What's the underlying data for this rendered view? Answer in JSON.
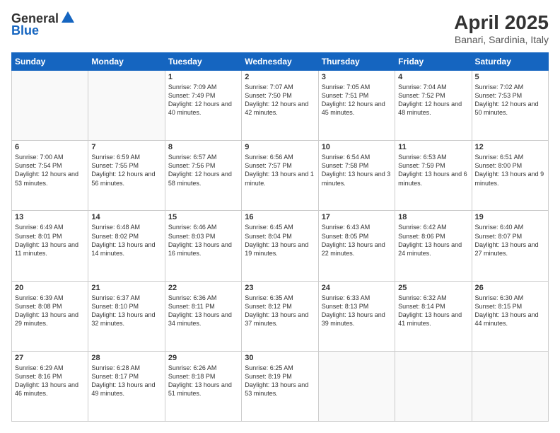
{
  "logo": {
    "line1": "General",
    "line2": "Blue"
  },
  "title": "April 2025",
  "subtitle": "Banari, Sardinia, Italy",
  "days_of_week": [
    "Sunday",
    "Monday",
    "Tuesday",
    "Wednesday",
    "Thursday",
    "Friday",
    "Saturday"
  ],
  "weeks": [
    [
      {
        "day": "",
        "info": ""
      },
      {
        "day": "",
        "info": ""
      },
      {
        "day": "1",
        "info": "Sunrise: 7:09 AM\nSunset: 7:49 PM\nDaylight: 12 hours and 40 minutes."
      },
      {
        "day": "2",
        "info": "Sunrise: 7:07 AM\nSunset: 7:50 PM\nDaylight: 12 hours and 42 minutes."
      },
      {
        "day": "3",
        "info": "Sunrise: 7:05 AM\nSunset: 7:51 PM\nDaylight: 12 hours and 45 minutes."
      },
      {
        "day": "4",
        "info": "Sunrise: 7:04 AM\nSunset: 7:52 PM\nDaylight: 12 hours and 48 minutes."
      },
      {
        "day": "5",
        "info": "Sunrise: 7:02 AM\nSunset: 7:53 PM\nDaylight: 12 hours and 50 minutes."
      }
    ],
    [
      {
        "day": "6",
        "info": "Sunrise: 7:00 AM\nSunset: 7:54 PM\nDaylight: 12 hours and 53 minutes."
      },
      {
        "day": "7",
        "info": "Sunrise: 6:59 AM\nSunset: 7:55 PM\nDaylight: 12 hours and 56 minutes."
      },
      {
        "day": "8",
        "info": "Sunrise: 6:57 AM\nSunset: 7:56 PM\nDaylight: 12 hours and 58 minutes."
      },
      {
        "day": "9",
        "info": "Sunrise: 6:56 AM\nSunset: 7:57 PM\nDaylight: 13 hours and 1 minute."
      },
      {
        "day": "10",
        "info": "Sunrise: 6:54 AM\nSunset: 7:58 PM\nDaylight: 13 hours and 3 minutes."
      },
      {
        "day": "11",
        "info": "Sunrise: 6:53 AM\nSunset: 7:59 PM\nDaylight: 13 hours and 6 minutes."
      },
      {
        "day": "12",
        "info": "Sunrise: 6:51 AM\nSunset: 8:00 PM\nDaylight: 13 hours and 9 minutes."
      }
    ],
    [
      {
        "day": "13",
        "info": "Sunrise: 6:49 AM\nSunset: 8:01 PM\nDaylight: 13 hours and 11 minutes."
      },
      {
        "day": "14",
        "info": "Sunrise: 6:48 AM\nSunset: 8:02 PM\nDaylight: 13 hours and 14 minutes."
      },
      {
        "day": "15",
        "info": "Sunrise: 6:46 AM\nSunset: 8:03 PM\nDaylight: 13 hours and 16 minutes."
      },
      {
        "day": "16",
        "info": "Sunrise: 6:45 AM\nSunset: 8:04 PM\nDaylight: 13 hours and 19 minutes."
      },
      {
        "day": "17",
        "info": "Sunrise: 6:43 AM\nSunset: 8:05 PM\nDaylight: 13 hours and 22 minutes."
      },
      {
        "day": "18",
        "info": "Sunrise: 6:42 AM\nSunset: 8:06 PM\nDaylight: 13 hours and 24 minutes."
      },
      {
        "day": "19",
        "info": "Sunrise: 6:40 AM\nSunset: 8:07 PM\nDaylight: 13 hours and 27 minutes."
      }
    ],
    [
      {
        "day": "20",
        "info": "Sunrise: 6:39 AM\nSunset: 8:08 PM\nDaylight: 13 hours and 29 minutes."
      },
      {
        "day": "21",
        "info": "Sunrise: 6:37 AM\nSunset: 8:10 PM\nDaylight: 13 hours and 32 minutes."
      },
      {
        "day": "22",
        "info": "Sunrise: 6:36 AM\nSunset: 8:11 PM\nDaylight: 13 hours and 34 minutes."
      },
      {
        "day": "23",
        "info": "Sunrise: 6:35 AM\nSunset: 8:12 PM\nDaylight: 13 hours and 37 minutes."
      },
      {
        "day": "24",
        "info": "Sunrise: 6:33 AM\nSunset: 8:13 PM\nDaylight: 13 hours and 39 minutes."
      },
      {
        "day": "25",
        "info": "Sunrise: 6:32 AM\nSunset: 8:14 PM\nDaylight: 13 hours and 41 minutes."
      },
      {
        "day": "26",
        "info": "Sunrise: 6:30 AM\nSunset: 8:15 PM\nDaylight: 13 hours and 44 minutes."
      }
    ],
    [
      {
        "day": "27",
        "info": "Sunrise: 6:29 AM\nSunset: 8:16 PM\nDaylight: 13 hours and 46 minutes."
      },
      {
        "day": "28",
        "info": "Sunrise: 6:28 AM\nSunset: 8:17 PM\nDaylight: 13 hours and 49 minutes."
      },
      {
        "day": "29",
        "info": "Sunrise: 6:26 AM\nSunset: 8:18 PM\nDaylight: 13 hours and 51 minutes."
      },
      {
        "day": "30",
        "info": "Sunrise: 6:25 AM\nSunset: 8:19 PM\nDaylight: 13 hours and 53 minutes."
      },
      {
        "day": "",
        "info": ""
      },
      {
        "day": "",
        "info": ""
      },
      {
        "day": "",
        "info": ""
      }
    ]
  ]
}
